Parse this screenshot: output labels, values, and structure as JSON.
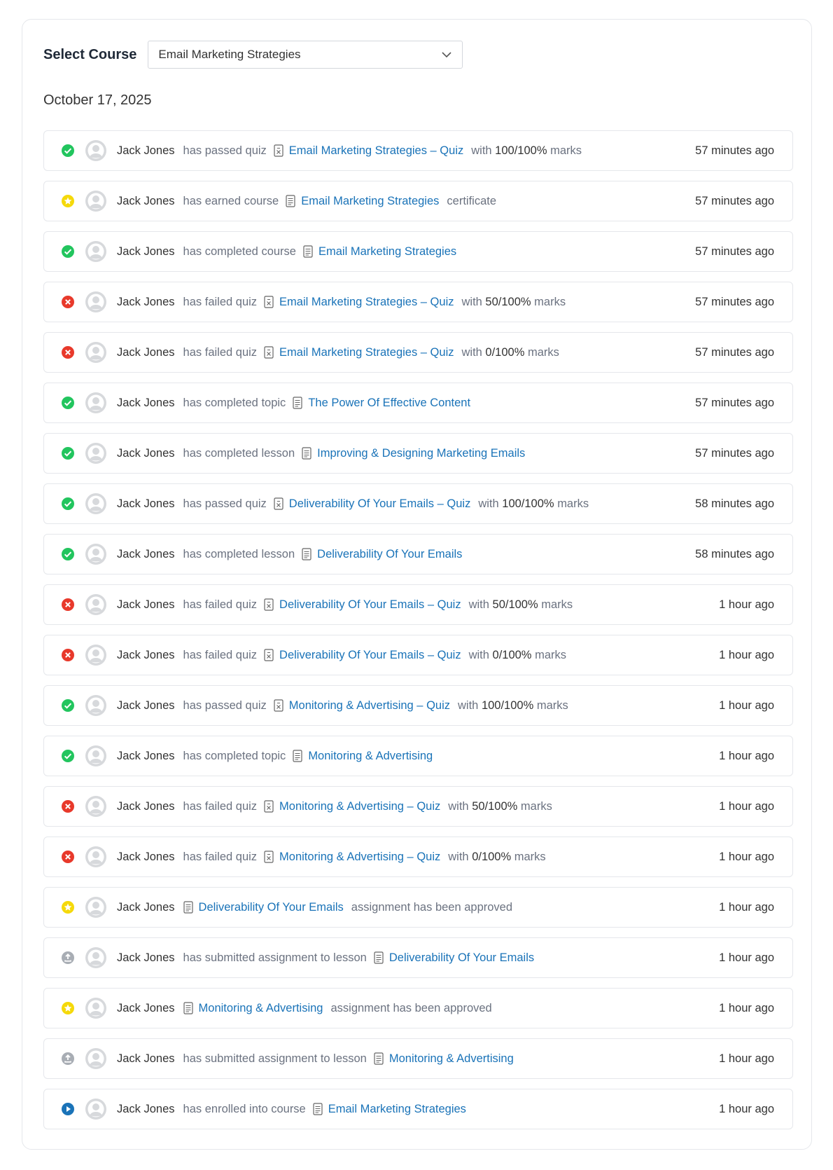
{
  "course_select": {
    "label": "Select Course",
    "selected": "Email Marketing Strategies"
  },
  "date": "October 17, 2025",
  "activities": [
    {
      "status": "passed",
      "user": "Jack Jones",
      "pre": "has passed quiz",
      "icon": "quiz-icon",
      "target": "Email Marketing Strategies – Quiz",
      "with": "with",
      "marks": "100/100%",
      "marks_word": "marks",
      "post": "",
      "time": "57 minutes ago"
    },
    {
      "status": "earned",
      "user": "Jack Jones",
      "pre": "has earned course",
      "icon": "document-icon",
      "target": "Email Marketing Strategies",
      "with": "",
      "marks": "",
      "marks_word": "",
      "post": "certificate",
      "time": "57 minutes ago"
    },
    {
      "status": "passed",
      "user": "Jack Jones",
      "pre": "has completed course",
      "icon": "document-icon",
      "target": "Email Marketing Strategies",
      "with": "",
      "marks": "",
      "marks_word": "",
      "post": "",
      "time": "57 minutes ago"
    },
    {
      "status": "failed",
      "user": "Jack Jones",
      "pre": "has failed quiz",
      "icon": "quiz-icon",
      "target": "Email Marketing Strategies – Quiz",
      "with": "with",
      "marks": "50/100%",
      "marks_word": "marks",
      "post": "",
      "time": "57 minutes ago"
    },
    {
      "status": "failed",
      "user": "Jack Jones",
      "pre": "has failed quiz",
      "icon": "quiz-icon",
      "target": "Email Marketing Strategies – Quiz",
      "with": "with",
      "marks": "0/100%",
      "marks_word": "marks",
      "post": "",
      "time": "57 minutes ago"
    },
    {
      "status": "passed",
      "user": "Jack Jones",
      "pre": "has completed topic",
      "icon": "document-icon",
      "target": "The Power Of Effective Content",
      "with": "",
      "marks": "",
      "marks_word": "",
      "post": "",
      "time": "57 minutes ago"
    },
    {
      "status": "passed",
      "user": "Jack Jones",
      "pre": "has completed lesson",
      "icon": "document-icon",
      "target": "Improving & Designing Marketing Emails",
      "with": "",
      "marks": "",
      "marks_word": "",
      "post": "",
      "time": "57 minutes ago"
    },
    {
      "status": "passed",
      "user": "Jack Jones",
      "pre": "has passed quiz",
      "icon": "quiz-icon",
      "target": "Deliverability Of Your Emails – Quiz",
      "with": "with",
      "marks": "100/100%",
      "marks_word": "marks",
      "post": "",
      "time": "58 minutes ago"
    },
    {
      "status": "passed",
      "user": "Jack Jones",
      "pre": "has completed lesson",
      "icon": "document-icon",
      "target": "Deliverability Of Your Emails",
      "with": "",
      "marks": "",
      "marks_word": "",
      "post": "",
      "time": "58 minutes ago"
    },
    {
      "status": "failed",
      "user": "Jack Jones",
      "pre": "has failed quiz",
      "icon": "quiz-icon",
      "target": "Deliverability Of Your Emails – Quiz",
      "with": "with",
      "marks": "50/100%",
      "marks_word": "marks",
      "post": "",
      "time": "1 hour ago"
    },
    {
      "status": "failed",
      "user": "Jack Jones",
      "pre": "has failed quiz",
      "icon": "quiz-icon",
      "target": "Deliverability Of Your Emails – Quiz",
      "with": "with",
      "marks": "0/100%",
      "marks_word": "marks",
      "post": "",
      "time": "1 hour ago"
    },
    {
      "status": "passed",
      "user": "Jack Jones",
      "pre": "has passed quiz",
      "icon": "quiz-icon",
      "target": "Monitoring & Advertising – Quiz",
      "with": "with",
      "marks": "100/100%",
      "marks_word": "marks",
      "post": "",
      "time": "1 hour ago"
    },
    {
      "status": "passed",
      "user": "Jack Jones",
      "pre": "has completed topic",
      "icon": "document-icon",
      "target": "Monitoring & Advertising",
      "with": "",
      "marks": "",
      "marks_word": "",
      "post": "",
      "time": "1 hour ago"
    },
    {
      "status": "failed",
      "user": "Jack Jones",
      "pre": "has failed quiz",
      "icon": "quiz-icon",
      "target": "Monitoring & Advertising – Quiz",
      "with": "with",
      "marks": "50/100%",
      "marks_word": "marks",
      "post": "",
      "time": "1 hour ago"
    },
    {
      "status": "failed",
      "user": "Jack Jones",
      "pre": "has failed quiz",
      "icon": "quiz-icon",
      "target": "Monitoring & Advertising – Quiz",
      "with": "with",
      "marks": "0/100%",
      "marks_word": "marks",
      "post": "",
      "time": "1 hour ago"
    },
    {
      "status": "earned",
      "user": "Jack Jones",
      "pre": "",
      "icon": "document-icon",
      "target": "Deliverability Of Your Emails",
      "with": "",
      "marks": "",
      "marks_word": "",
      "post": "assignment has been approved",
      "time": "1 hour ago"
    },
    {
      "status": "submitted",
      "user": "Jack Jones",
      "pre": "has submitted assignment to lesson",
      "icon": "document-icon",
      "target": "Deliverability Of Your Emails",
      "with": "",
      "marks": "",
      "marks_word": "",
      "post": "",
      "time": "1 hour ago"
    },
    {
      "status": "earned",
      "user": "Jack Jones",
      "pre": "",
      "icon": "document-icon",
      "target": "Monitoring & Advertising",
      "with": "",
      "marks": "",
      "marks_word": "",
      "post": "assignment has been approved",
      "time": "1 hour ago"
    },
    {
      "status": "submitted",
      "user": "Jack Jones",
      "pre": "has submitted assignment to lesson",
      "icon": "document-icon",
      "target": "Monitoring & Advertising",
      "with": "",
      "marks": "",
      "marks_word": "",
      "post": "",
      "time": "1 hour ago"
    },
    {
      "status": "enrolled",
      "user": "Jack Jones",
      "pre": "has enrolled into course",
      "icon": "document-icon",
      "target": "Email Marketing Strategies",
      "with": "",
      "marks": "",
      "marks_word": "",
      "post": "",
      "time": "1 hour ago"
    }
  ],
  "colors": {
    "passed": "#22c55e",
    "failed": "#e8392b",
    "earned": "#f5d90a",
    "submitted": "#a8adb4",
    "enrolled": "#1a73b8",
    "link": "#1a73b8",
    "muted": "#6b7280"
  }
}
